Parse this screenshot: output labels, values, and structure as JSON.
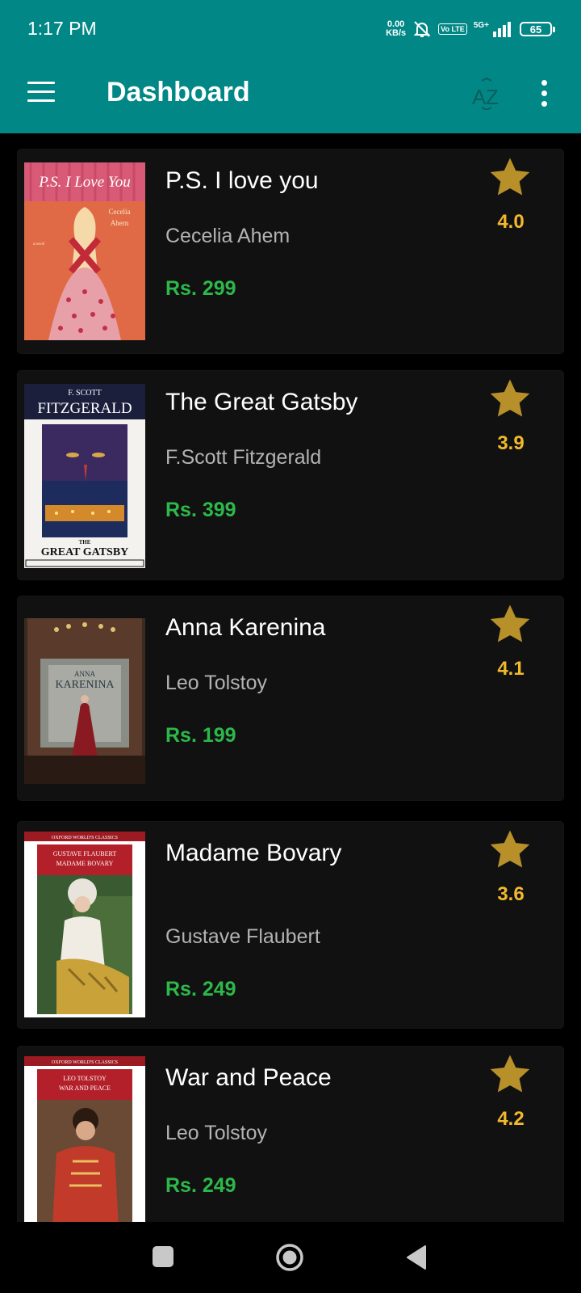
{
  "status_bar": {
    "time": "1:17 PM",
    "net_speed_value": "0.00",
    "net_speed_unit": "KB/s",
    "network_label": "5G+",
    "volte_label": "Vo LTE",
    "battery_level": "65",
    "icons": [
      "mute-bell-icon",
      "volte-icon",
      "signal-icon",
      "battery-icon"
    ]
  },
  "toolbar": {
    "title": "Dashboard",
    "menu_icon": "hamburger-icon",
    "sort_icon": "sort-az-icon",
    "overflow_icon": "more-vert-icon"
  },
  "books": [
    {
      "title": "P.S. I love you",
      "author": "Cecelia Ahem",
      "price": "Rs. 299",
      "rating": "4.0",
      "cover_text": [
        "P.S. I Love You",
        "Cecelia",
        "Ahern",
        "a novel"
      ]
    },
    {
      "title": "The Great Gatsby",
      "author": "F.Scott Fitzgerald",
      "price": "Rs. 399",
      "rating": "3.9",
      "cover_text": [
        "F. SCOTT",
        "FITZGERALD",
        "THE",
        "GREAT GATSBY"
      ]
    },
    {
      "title": "Anna Karenina",
      "author": "Leo Tolstoy",
      "price": "Rs. 199",
      "rating": "4.1",
      "cover_text": [
        "ANNA",
        "KARENINA"
      ]
    },
    {
      "title": "Madame Bovary",
      "author": "Gustave Flaubert",
      "price": "Rs. 249",
      "rating": "3.6",
      "cover_text": [
        "OXFORD WORLD'S CLASSICS",
        "GUSTAVE FLAUBERT",
        "MADAME BOVARY"
      ]
    },
    {
      "title": "War and Peace",
      "author": "Leo Tolstoy",
      "price": "Rs. 249",
      "rating": "4.2",
      "cover_text": [
        "OXFORD WORLD'S CLASSICS",
        "LEO TOLSTOY",
        "WAR AND PEACE"
      ]
    }
  ],
  "colors": {
    "app_bar": "#018786",
    "card_background": "#111111",
    "price": "#2db84a",
    "rating": "#f2b92c",
    "star": "#b8902a"
  },
  "nav_bar": {
    "icons": [
      "recent-apps-icon",
      "home-icon",
      "back-icon"
    ]
  }
}
